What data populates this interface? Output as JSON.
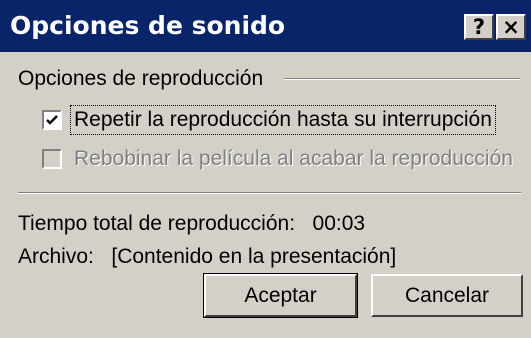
{
  "window": {
    "title": "Opciones de sonido",
    "help_button": "?",
    "close_button": "×"
  },
  "playback_options": {
    "group_label": "Opciones de reproducción",
    "loop_checkbox": {
      "label": "Repetir la reproducción hasta su interrupción",
      "checked": true,
      "enabled": true
    },
    "rewind_checkbox": {
      "label": "Rebobinar la película al acabar la reproducción",
      "checked": false,
      "enabled": false
    }
  },
  "info": {
    "total_time": "Tiempo total de reproducción:   00:03",
    "file": "Archivo:   [Contenido en la presentación]"
  },
  "buttons": {
    "ok": "Aceptar",
    "cancel": "Cancelar"
  },
  "colors": {
    "titlebar": "#0a246a",
    "dialog_bg": "#d4d0c8",
    "disabled_text": "#808080"
  }
}
